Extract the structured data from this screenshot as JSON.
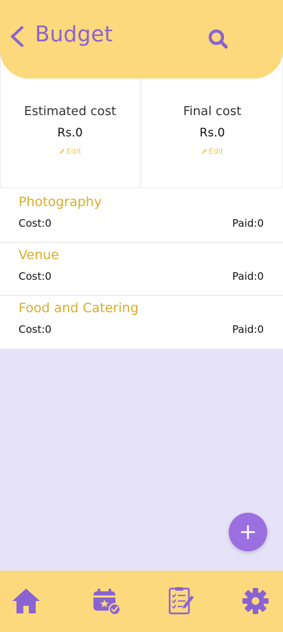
{
  "colors": {
    "accent": "#8a63d2",
    "header_bg": "#fcd97c",
    "page_bg": "#e6e2f7",
    "item_name": "#d9ad2a",
    "fab": "#9b6fe0"
  },
  "header": {
    "title": "Budget",
    "back_icon": "chevron-left-icon",
    "search_icon": "search-icon"
  },
  "summary": {
    "estimated": {
      "label": "Estimated cost",
      "value": "Rs.0",
      "edit_label": "Edit"
    },
    "final": {
      "label": "Final cost",
      "value": "Rs.0",
      "edit_label": "Edit"
    }
  },
  "items": [
    {
      "name": "Photography",
      "cost": "Cost:0",
      "paid": "Paid:0"
    },
    {
      "name": "Venue",
      "cost": "Cost:0",
      "paid": "Paid:0"
    },
    {
      "name": "Food and Catering",
      "cost": "Cost:0",
      "paid": "Paid:0"
    }
  ],
  "fab": {
    "icon": "plus-icon"
  },
  "nav": {
    "items": [
      {
        "icon": "home-icon"
      },
      {
        "icon": "event-calendar-icon"
      },
      {
        "icon": "checklist-icon"
      },
      {
        "icon": "gear-icon"
      }
    ]
  }
}
